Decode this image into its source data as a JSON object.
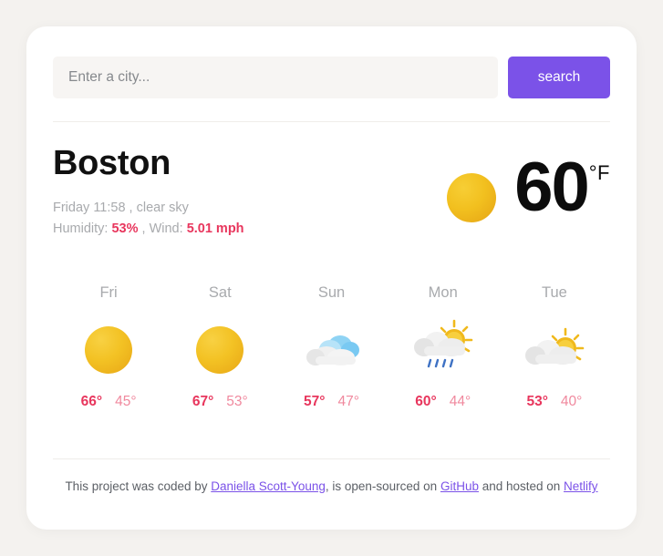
{
  "search": {
    "placeholder": "Enter a city...",
    "value": "",
    "button_label": "search"
  },
  "current": {
    "city": "Boston",
    "conditions_line": "Friday 11:58 , clear sky",
    "humidity_label": "Humidity: ",
    "humidity_value": "53%",
    "wind_separator": " , Wind: ",
    "wind_value": "5.01 mph",
    "temperature": "60",
    "unit": "°F",
    "icon": "sun-icon"
  },
  "forecast": [
    {
      "day": "Fri",
      "icon": "sun-icon",
      "max": "66°",
      "min": "45°"
    },
    {
      "day": "Sat",
      "icon": "sun-icon",
      "max": "67°",
      "min": "53°"
    },
    {
      "day": "Sun",
      "icon": "cloudy-icon",
      "max": "57°",
      "min": "47°"
    },
    {
      "day": "Mon",
      "icon": "sun-shower-icon",
      "max": "60°",
      "min": "44°"
    },
    {
      "day": "Tue",
      "icon": "partly-cloudy-icon",
      "max": "53°",
      "min": "40°"
    }
  ],
  "footer": {
    "prefix": "This project was coded by ",
    "author": "Daniella Scott-Young",
    "middle": ", is open-sourced on ",
    "source": "GitHub",
    "between": " and hosted on ",
    "host": "Netlify"
  },
  "colors": {
    "accent_purple": "#7b52e8",
    "temp_max": "#e8365d",
    "temp_min": "#f0899e",
    "page_bg": "#f4f2ef",
    "card_bg": "#ffffff",
    "muted_text": "#a8aaad",
    "sun_yellow": "#f3c224"
  }
}
